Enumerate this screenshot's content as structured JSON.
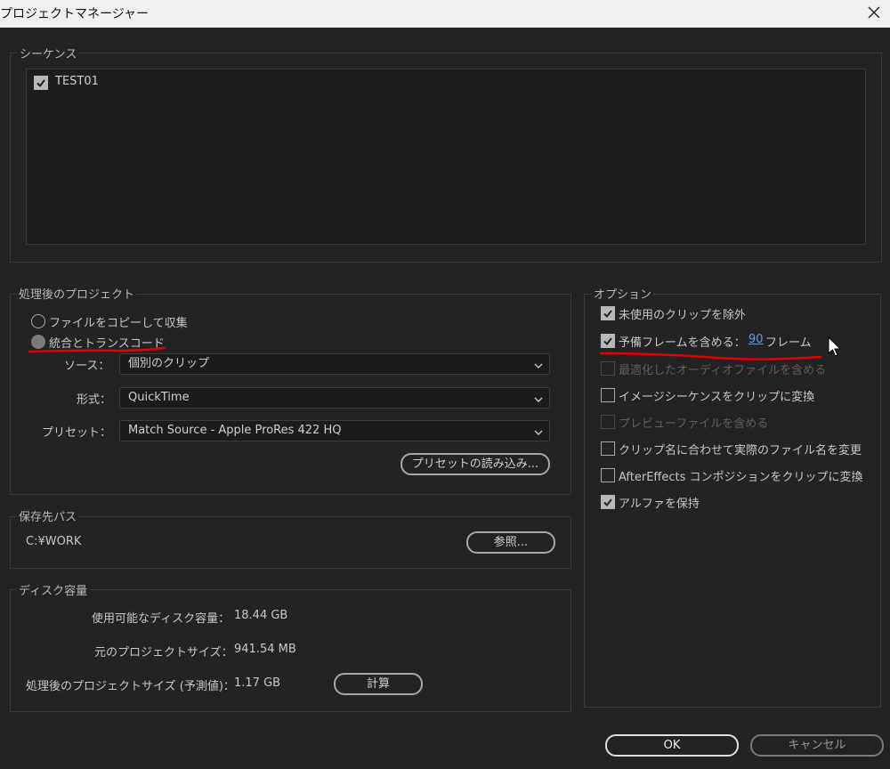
{
  "window": {
    "title": "プロジェクトマネージャー"
  },
  "sequences": {
    "label": "シーケンス",
    "items": [
      {
        "name": "TEST01",
        "checked": true
      }
    ]
  },
  "processed_project": {
    "label": "処理後のプロジェクト",
    "radio_copy": "ファイルをコピーして収集",
    "radio_consolidate": "統合とトランスコード",
    "source_label": "ソース：",
    "source_value": "個別のクリップ",
    "format_label": "形式：",
    "format_value": "QuickTime",
    "preset_label": "プリセット：",
    "preset_value": "Match Source - Apple ProRes 422 HQ",
    "load_preset_button": "プリセットの読み込み..."
  },
  "destination": {
    "label": "保存先パス",
    "path": "C:¥WORK",
    "browse_button": "参照..."
  },
  "disk_space": {
    "label": "ディスク容量",
    "available_label": "使用可能なディスク容量：",
    "available_value": "18.44 GB",
    "original_label": "元のプロジェクトサイズ：",
    "original_value": "941.54 MB",
    "estimated_label": "処理後のプロジェクトサイズ (予測値)：",
    "estimated_value": "1.17 GB",
    "calculate_button": "計算"
  },
  "options": {
    "label": "オプション",
    "exclude_unused": "未使用のクリップを除外",
    "handle_frames_prefix": "予備フレームを含める：",
    "handle_frames_value": "90",
    "handle_frames_suffix": "フレーム",
    "optimized_audio": "最適化したオーディオファイルを含める",
    "image_sequence": "イメージシーケンスをクリップに変換",
    "preview_files": "プレビューファイルを含める",
    "rename_files": "クリップ名に合わせて実際のファイル名を変更",
    "after_effects": "AfterEffects コンポジションをクリップに変換",
    "preserve_alpha": "アルファを保持"
  },
  "footer": {
    "ok_button": "OK",
    "cancel_button": "キャンセル"
  },
  "colors": {
    "background": "#232323",
    "annotation": "#e00000",
    "link": "#5a9ee8"
  }
}
